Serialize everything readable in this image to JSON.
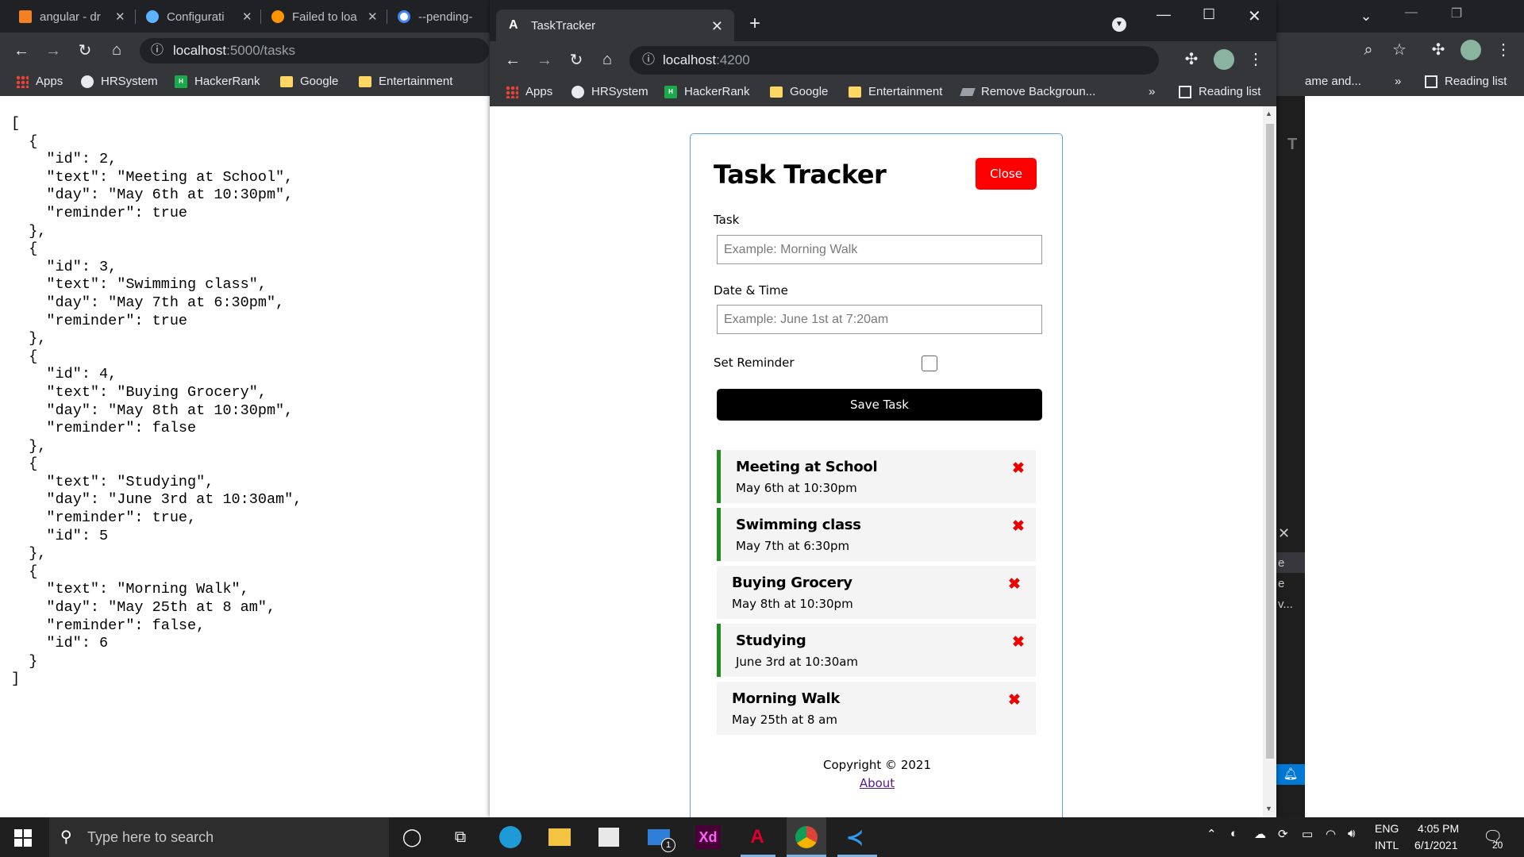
{
  "bg_browser": {
    "tabs": [
      {
        "title": "angular - dr",
        "icon": "stackoverflow-icon",
        "color": "#f48024"
      },
      {
        "title": "Configurati",
        "icon": "hex-icon",
        "color": "#5cb3ff"
      },
      {
        "title": "Failed to loa",
        "icon": "firefox-icon",
        "color": "#ff9500"
      },
      {
        "title": "--pending-",
        "icon": "google-icon",
        "color": "#ffffff"
      }
    ],
    "url_host": "localhost",
    "url_path": ":5000/tasks",
    "bookmarks": [
      "Apps",
      "HRSystem",
      "HackerRank",
      "Google",
      "Entertainment"
    ],
    "bookmarks_right": [
      "ame and...",
      "Reading list"
    ],
    "json_text": "[\n  {\n    \"id\": 2,\n    \"text\": \"Meeting at School\",\n    \"day\": \"May 6th at 10:30pm\",\n    \"reminder\": true\n  },\n  {\n    \"id\": 3,\n    \"text\": \"Swimming class\",\n    \"day\": \"May 7th at 6:30pm\",\n    \"reminder\": true\n  },\n  {\n    \"id\": 4,\n    \"text\": \"Buying Grocery\",\n    \"day\": \"May 8th at 10:30pm\",\n    \"reminder\": false\n  },\n  {\n    \"text\": \"Studying\",\n    \"day\": \"June 3rd at 10:30am\",\n    \"reminder\": true,\n    \"id\": 5\n  },\n  {\n    \"text\": \"Morning Walk\",\n    \"day\": \"May 25th at 8 am\",\n    \"reminder\": false,\n    \"id\": 6\n  }\n]"
  },
  "fg_browser": {
    "tab_title": "TaskTracker",
    "url_host": "localhost",
    "url_path": ":4200",
    "bookmarks": [
      "Apps",
      "HRSystem",
      "HackerRank",
      "Google",
      "Entertainment",
      "Remove Backgroun..."
    ],
    "more": "»",
    "reading_list": "Reading list"
  },
  "app": {
    "title": "Task Tracker",
    "close_label": "Close",
    "task_label": "Task",
    "task_placeholder": "Example: Morning Walk",
    "date_label": "Date & Time",
    "date_placeholder": "Example: June 1st at 7:20am",
    "reminder_label": "Set Reminder",
    "save_label": "Save Task",
    "tasks": [
      {
        "text": "Meeting at School",
        "day": "May 6th at 10:30pm",
        "reminder": true
      },
      {
        "text": "Swimming class",
        "day": "May 7th at 6:30pm",
        "reminder": true
      },
      {
        "text": "Buying Grocery",
        "day": "May 8th at 10:30pm",
        "reminder": false
      },
      {
        "text": "Studying",
        "day": "June 3rd at 10:30am",
        "reminder": true
      },
      {
        "text": "Morning Walk",
        "day": "May 25th at 8 am",
        "reminder": false
      }
    ],
    "delete_glyph": "✖",
    "copyright": "Copyright © 2021",
    "about": "About",
    "colors": {
      "close": "#ff0000",
      "reminder_border": "#1e8c1e",
      "delete": "#ee0000"
    }
  },
  "side_app": {
    "lines": [
      "e",
      "e",
      "v..."
    ]
  },
  "taskbar": {
    "search_placeholder": "Type here to search",
    "mail_badge": "1",
    "lang_1": "ENG",
    "lang_2": "INTL",
    "time": "4:05 PM",
    "date": "6/1/2021",
    "notif_count": "20"
  }
}
